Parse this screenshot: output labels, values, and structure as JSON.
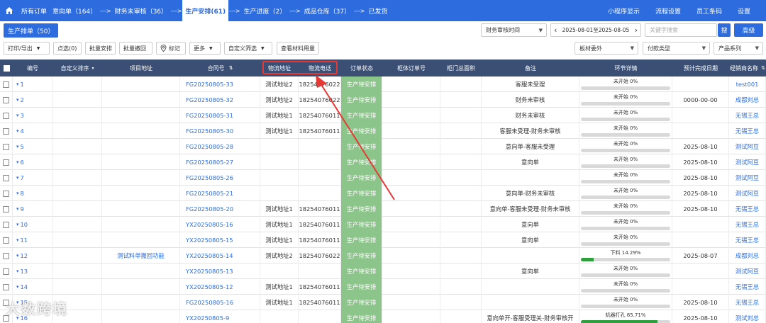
{
  "nav": {
    "steps": [
      {
        "label": "所有订单"
      },
      {
        "label": "意向单（164）"
      },
      {
        "label": "财务未审核（36）"
      },
      {
        "label": "生产安排(61)"
      },
      {
        "label": "生产进度（2）"
      },
      {
        "label": "成品仓库（37）"
      },
      {
        "label": "已发货"
      }
    ],
    "arrow": "--->",
    "right": [
      "小程序显示",
      "流程设置",
      "员工条码",
      "设置"
    ]
  },
  "subbar": {
    "tab": "生产排单（50）",
    "time_select": "财务审核时间",
    "date_range": "2025-08-01至2025-08-05",
    "prev": "‹",
    "next": "›",
    "search_placeholder": "关键字搜索",
    "search_btn": "搜",
    "advanced": "高级"
  },
  "toolbar": {
    "print_export": "打印/导出",
    "select_count": "点选(0)",
    "batch_arrange": "批量安排",
    "batch_withdraw": "批量撤回",
    "mark": "标记",
    "more": "更多",
    "custom_filter": "自定义筛选",
    "view_material": "查看材料用量",
    "board_outsource": "板材委外",
    "payment_type": "付款类型",
    "product_series": "产品系列"
  },
  "table": {
    "headers": {
      "no": "编号",
      "custom_sort": "自定义排序",
      "project_addr": "项目地址",
      "contract_no": "合同号",
      "logistics_addr": "物流地址",
      "logistics_phone": "物流电话",
      "order_status": "订单状态",
      "cabinet_order": "柜体订单号",
      "door_area": "柜门总面积",
      "remark": "备注",
      "step_detail": "环节详情",
      "est_finish": "预计完成日期",
      "dealer": "经销商名称"
    },
    "rows": [
      {
        "no": "1",
        "project": "",
        "contract": "FG20250805-33",
        "addr": "测试地址2",
        "phone": "18254076022",
        "status": "生产待安排",
        "remark": "客服未受理",
        "progress_label": "未开始 0%",
        "progress": 0,
        "date": "",
        "dealer": "test001"
      },
      {
        "no": "2",
        "project": "",
        "contract": "FG20250805-32",
        "addr": "测试地址2",
        "phone": "18254076022",
        "status": "生产待安排",
        "remark": "财务未审核",
        "progress_label": "未开始 0%",
        "progress": 0,
        "date": "0000-00-00",
        "dealer": "成都刘总"
      },
      {
        "no": "3",
        "project": "",
        "contract": "FG20250805-31",
        "addr": "测试地址1",
        "phone": "18254076011",
        "status": "生产待安排",
        "remark": "财务未审核",
        "progress_label": "未开始 0%",
        "progress": 0,
        "date": "",
        "dealer": "无锡王总"
      },
      {
        "no": "4",
        "project": "",
        "contract": "FG20250805-30",
        "addr": "测试地址1",
        "phone": "18254076011",
        "status": "生产待安排",
        "remark": "客服未受理-财务未审核",
        "progress_label": "未开始 0%",
        "progress": 0,
        "date": "",
        "dealer": "无锡王总"
      },
      {
        "no": "5",
        "project": "",
        "contract": "FG20250805-28",
        "addr": "",
        "phone": "",
        "status": "生产待安排",
        "remark": "意向单-客服未受理",
        "progress_label": "未开始 0%",
        "progress": 0,
        "date": "2025-08-10",
        "dealer": "测试阿豆"
      },
      {
        "no": "6",
        "project": "",
        "contract": "FG20250805-27",
        "addr": "",
        "phone": "",
        "status": "生产待安排",
        "remark": "意向单",
        "progress_label": "未开始 0%",
        "progress": 0,
        "date": "2025-08-10",
        "dealer": "测试阿豆"
      },
      {
        "no": "7",
        "project": "",
        "contract": "FG20250805-26",
        "addr": "",
        "phone": "",
        "status": "生产待安排",
        "remark": "",
        "progress_label": "未开始 0%",
        "progress": 0,
        "date": "2025-08-10",
        "dealer": "测试阿豆"
      },
      {
        "no": "8",
        "project": "",
        "contract": "FG20250805-21",
        "addr": "",
        "phone": "",
        "status": "生产待安排",
        "remark": "意向单-财务未审核",
        "progress_label": "未开始 0%",
        "progress": 0,
        "date": "2025-08-10",
        "dealer": "测试阿豆"
      },
      {
        "no": "9",
        "project": "",
        "contract": "FG20250805-20",
        "addr": "测试地址1",
        "phone": "18254076011",
        "status": "生产待安排",
        "remark": "意向单-客服未受理-财务未审核",
        "progress_label": "未开始 0%",
        "progress": 0,
        "date": "2025-08-10",
        "dealer": "无锡王总"
      },
      {
        "no": "10",
        "project": "",
        "contract": "YX20250805-16",
        "addr": "测试地址1",
        "phone": "18254076011",
        "status": "生产待安排",
        "remark": "意向单",
        "progress_label": "未开始 0%",
        "progress": 0,
        "date": "",
        "dealer": "无锡王总"
      },
      {
        "no": "11",
        "project": "",
        "contract": "YX20250805-15",
        "addr": "测试地址1",
        "phone": "18254076011",
        "status": "生产待安排",
        "remark": "意向单",
        "progress_label": "未开始 0%",
        "progress": 0,
        "date": "",
        "dealer": "无锡王总"
      },
      {
        "no": "12",
        "project": "测试料单撤回功能",
        "contract": "YX20250805-14",
        "addr": "测试地址2",
        "phone": "18254076022",
        "status": "生产待安排",
        "remark": "",
        "progress_label": "下料 14.29%",
        "progress": 14.29,
        "date": "2025-08-07",
        "dealer": "成都刘总"
      },
      {
        "no": "13",
        "project": "",
        "contract": "YX20250805-13",
        "addr": "",
        "phone": "",
        "status": "生产待安排",
        "remark": "意向单",
        "progress_label": "未开始 0%",
        "progress": 0,
        "date": "",
        "dealer": "测试阿豆"
      },
      {
        "no": "14",
        "project": "",
        "contract": "YX20250805-12",
        "addr": "测试地址1",
        "phone": "18254076011",
        "status": "生产待安排",
        "remark": "",
        "progress_label": "未开始 0%",
        "progress": 0,
        "date": "",
        "dealer": "无锡王总"
      },
      {
        "no": "15",
        "project": "",
        "contract": "FG20250805-16",
        "addr": "测试地址1",
        "phone": "18254076011",
        "status": "生产待安排",
        "remark": "",
        "progress_label": "未开始 0%",
        "progress": 0,
        "date": "2025-08-10",
        "dealer": "无锡王总"
      },
      {
        "no": "16",
        "project": "",
        "contract": "YX20250805-9",
        "addr": "",
        "phone": "",
        "status": "生产待安排",
        "remark": "意向单开-客服受理关-财务审核开",
        "progress_label": "机器打孔 85.71%",
        "progress": 85.71,
        "date": "2025-08-10",
        "dealer": "测试刘总"
      }
    ]
  },
  "watermark": "大数跨境",
  "colors": {
    "nav": "#2d6cdf",
    "header": "#3a4f73",
    "status": "#8bc58a",
    "annotation": "#e53935",
    "progress": "#2f9e3c"
  }
}
